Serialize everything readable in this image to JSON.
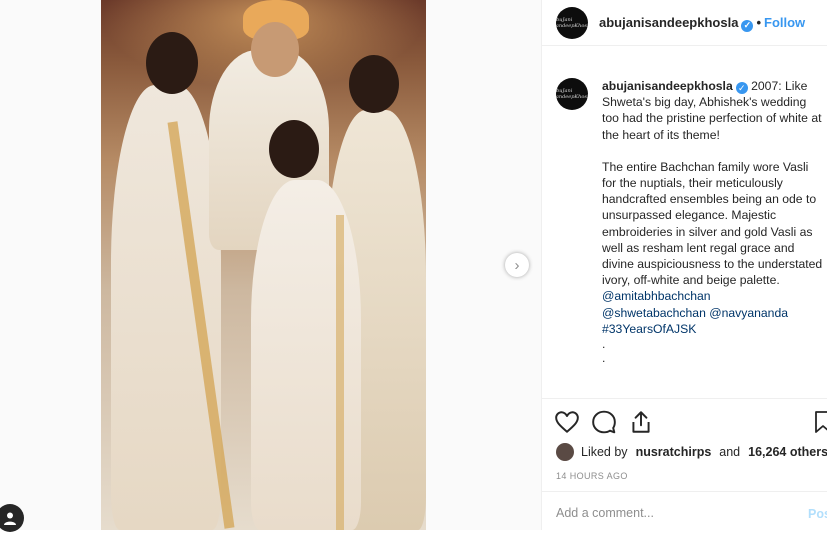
{
  "post": {
    "author": "abujanisandeepkhosla",
    "follow_label": "Follow",
    "separator": "•",
    "avatar_text": "AbuJani SandeepKhosla",
    "caption": {
      "first_line": "2007: Like Shweta's big day, Abhishek's wedding too had the pristine perfection of white at the heart of its theme!",
      "paragraph2": "The entire Bachchan family wore Vasli for the nuptials, their meticulously handcrafted ensembles being an ode to unsurpassed elegance. Majestic embroideries in silver and gold Vasli as well as resham lent regal grace and divine auspiciousness to the understated ivory, off-white and beige palette.",
      "mention1": "@amitabhbachchan",
      "mention2": "@shwetabachchan",
      "mention3": "@navyananda",
      "hashtag": "#33YearsOfAJSK",
      "dot1": ".",
      "dot2": "."
    },
    "likes": {
      "prefix": "Liked by",
      "user": "nusratchirps",
      "conjunction": "and",
      "count": "16,264 others"
    },
    "timestamp": "14 HOURS AGO",
    "comment": {
      "placeholder": "Add a comment...",
      "post_label": "Post"
    }
  },
  "icons": {
    "like": "heart-icon",
    "comment": "comment-icon",
    "share": "share-icon",
    "save": "bookmark-icon",
    "next": "chevron-right-icon",
    "profile": "user-profile-icon",
    "verified": "verified-badge-icon"
  },
  "colors": {
    "link": "#3897f0",
    "mention": "#003569",
    "muted": "#8e8e8e",
    "text": "#262626"
  }
}
